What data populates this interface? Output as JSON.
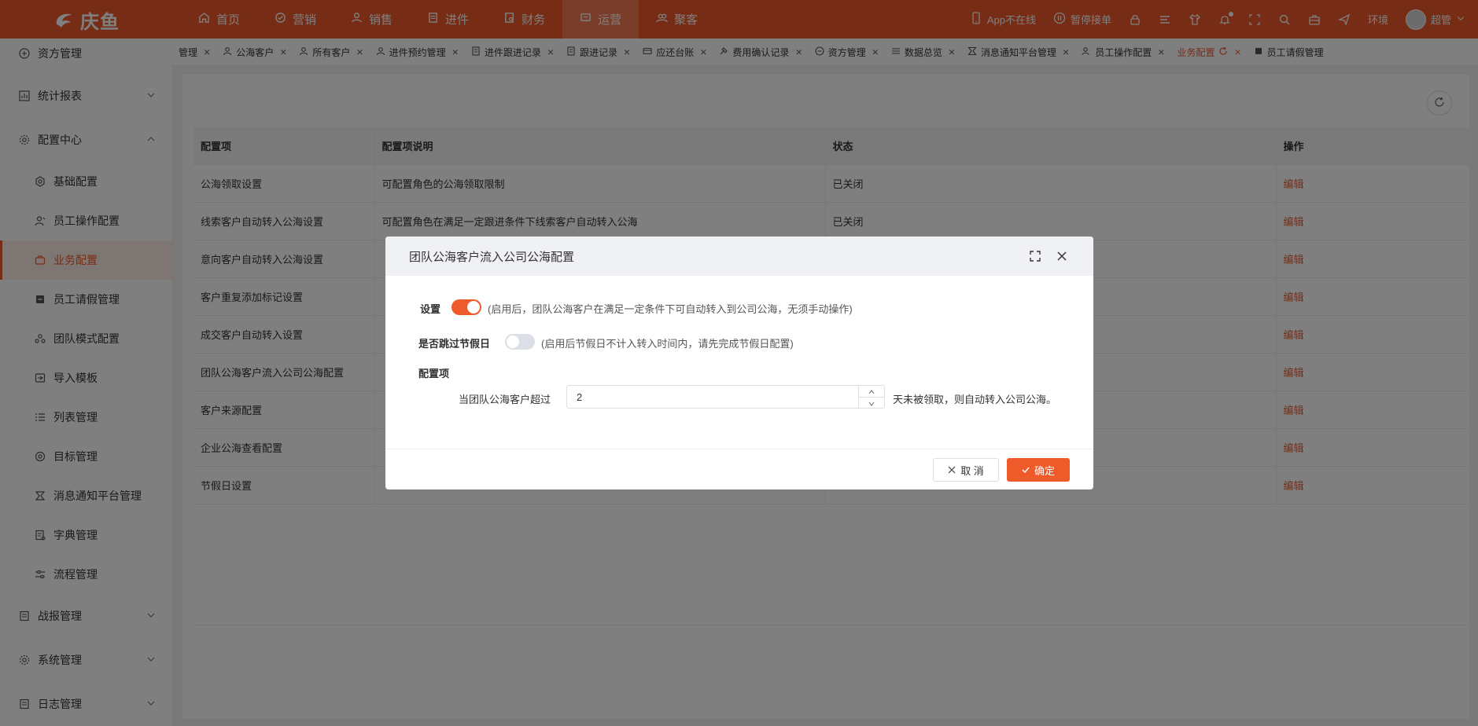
{
  "brand": {
    "name": "庆鱼"
  },
  "topnav": [
    {
      "label": "首页",
      "icon": "home-icon"
    },
    {
      "label": "营销",
      "icon": "badge-icon"
    },
    {
      "label": "销售",
      "icon": "user-icon"
    },
    {
      "label": "进件",
      "icon": "document-icon"
    },
    {
      "label": "财务",
      "icon": "finance-icon"
    },
    {
      "label": "运营",
      "icon": "operation-icon",
      "active": true
    },
    {
      "label": "聚客",
      "icon": "group-icon"
    }
  ],
  "topright": {
    "app_status": "App不在线",
    "pause_label": "暂停接单",
    "env_label": "环境",
    "user_name": "超管"
  },
  "sidebar": {
    "items": [
      {
        "label": "资方管理",
        "icon": "capital-icon",
        "level": "top"
      },
      {
        "label": "统计报表",
        "icon": "chart-icon",
        "level": "top",
        "chevron": "down"
      },
      {
        "label": "配置中心",
        "icon": "gear-icon",
        "level": "top",
        "chevron": "up"
      },
      {
        "label": "基础配置",
        "icon": "settings-icon",
        "level": "sub"
      },
      {
        "label": "员工操作配置",
        "icon": "staff-icon",
        "level": "sub"
      },
      {
        "label": "业务配置",
        "icon": "briefcase-icon",
        "level": "sub",
        "active": true
      },
      {
        "label": "员工请假管理",
        "icon": "leave-icon",
        "level": "sub"
      },
      {
        "label": "团队模式配置",
        "icon": "team-icon",
        "level": "sub"
      },
      {
        "label": "导入模板",
        "icon": "import-icon",
        "level": "sub"
      },
      {
        "label": "列表管理",
        "icon": "list-icon",
        "level": "sub"
      },
      {
        "label": "目标管理",
        "icon": "target-icon",
        "level": "sub"
      },
      {
        "label": "消息通知平台管理",
        "icon": "notify-icon",
        "level": "sub"
      },
      {
        "label": "字典管理",
        "icon": "dictionary-icon",
        "level": "sub"
      },
      {
        "label": "流程管理",
        "icon": "flow-icon",
        "level": "sub"
      },
      {
        "label": "战报管理",
        "icon": "report-icon",
        "level": "top",
        "chevron": "down"
      },
      {
        "label": "系统管理",
        "icon": "system-icon",
        "level": "top",
        "chevron": "down"
      },
      {
        "label": "日志管理",
        "icon": "log-icon",
        "level": "top",
        "chevron": "down"
      }
    ]
  },
  "tabs": [
    {
      "label": "管理"
    },
    {
      "label": "公海客户"
    },
    {
      "label": "所有客户"
    },
    {
      "label": "进件预约管理"
    },
    {
      "label": "进件跟进记录"
    },
    {
      "label": "跟进记录"
    },
    {
      "label": "应还台账"
    },
    {
      "label": "费用确认记录"
    },
    {
      "label": "资方管理"
    },
    {
      "label": "数据总览"
    },
    {
      "label": "消息通知平台管理"
    },
    {
      "label": "员工操作配置"
    },
    {
      "label": "业务配置",
      "active": true
    },
    {
      "label": "员工请假管理"
    }
  ],
  "table": {
    "headers": [
      "配置项",
      "配置项说明",
      "状态",
      "操作"
    ],
    "rows": [
      [
        "公海领取设置",
        "可配置角色的公海领取限制",
        "已关闭",
        "编辑"
      ],
      [
        "线索客户自动转入公海设置",
        "可配置角色在满足一定跟进条件下线索客户自动转入公海",
        "已关闭",
        "编辑"
      ],
      [
        "意向客户自动转入公海设置",
        "",
        "",
        "编辑"
      ],
      [
        "客户重复添加标记设置",
        "",
        "",
        "编辑"
      ],
      [
        "成交客户自动转入设置",
        "",
        "",
        "编辑"
      ],
      [
        "团队公海客户流入公司公海配置",
        "",
        "",
        "编辑"
      ],
      [
        "客户来源配置",
        "",
        "",
        "编辑"
      ],
      [
        "企业公海查看配置",
        "",
        "",
        "编辑"
      ],
      [
        "节假日设置",
        "",
        "",
        "编辑"
      ]
    ]
  },
  "modal": {
    "title": "团队公海客户流入公司公海配置",
    "setting_label": "设置",
    "setting_on": true,
    "setting_hint": "(启用后，团队公海客户在满足一定条件下可自动转入到公司公海，无须手动操作)",
    "skip_label": "是否跳过节假日",
    "skip_on": false,
    "skip_hint": "(启用后节假日不计入转入时间内，请先完成节假日配置)",
    "config_label": "配置项",
    "prefix": "当团队公海客户超过",
    "value": "2",
    "suffix": "天未被领取，则自动转入公司公海。",
    "cancel": "取 消",
    "ok": "确定"
  },
  "colors": {
    "accent": "#ef5a2a"
  }
}
